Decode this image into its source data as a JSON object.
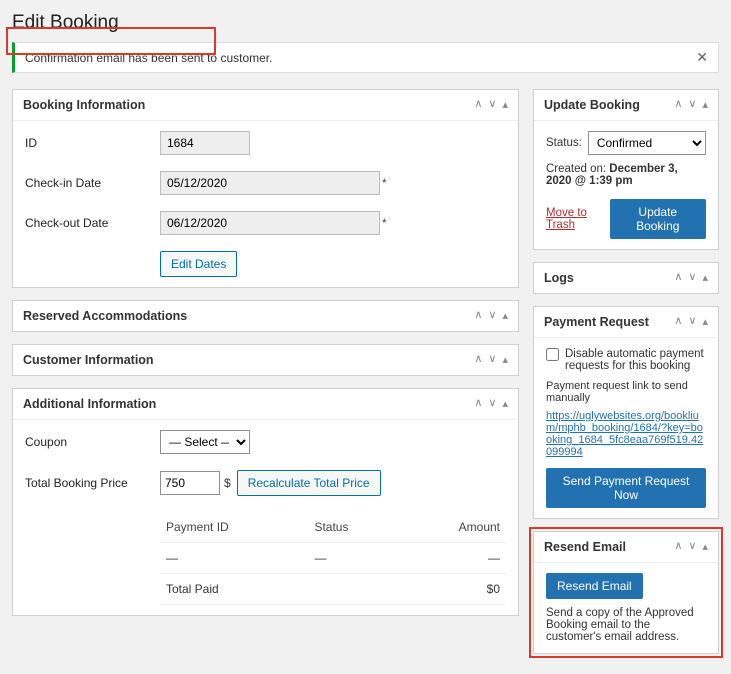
{
  "page_title": "Edit Booking",
  "notice_text": "Confirmation email has been sent to customer.",
  "booking_info": {
    "panel_title": "Booking Information",
    "id_label": "ID",
    "id_value": "1684",
    "checkin_label": "Check-in Date",
    "checkin_value": "05/12/2020",
    "checkout_label": "Check-out Date",
    "checkout_value": "06/12/2020",
    "edit_dates_btn": "Edit Dates"
  },
  "reserved_panel_title": "Reserved Accommodations",
  "customer_panel_title": "Customer Information",
  "additional": {
    "panel_title": "Additional Information",
    "coupon_label": "Coupon",
    "coupon_select": "— Select —",
    "total_label": "Total Booking Price",
    "total_value": "750",
    "currency": "$",
    "recalc_btn": "Recalculate Total Price",
    "col_payment_id": "Payment ID",
    "col_status": "Status",
    "col_amount": "Amount",
    "dash": "—",
    "total_paid_label": "Total Paid",
    "total_paid_value": "$0"
  },
  "update": {
    "panel_title": "Update Booking",
    "status_label": "Status:",
    "status_value": "Confirmed",
    "created_prefix": "Created on: ",
    "created_value": "December 3, 2020 @ 1:39 pm",
    "trash": "Move to Trash",
    "button": "Update Booking"
  },
  "logs_panel_title": "Logs",
  "payment_request": {
    "panel_title": "Payment Request",
    "disable_label": "Disable automatic payment requests for this booking",
    "link_intro": "Payment request link to send manually",
    "link_text": "https://uglywebsites.org/booklium/mphb_booking/1684/?key=booking_1684_5fc8eaa769f519.42099994",
    "button": "Send Payment Request Now"
  },
  "resend": {
    "panel_title": "Resend Email",
    "button": "Resend Email",
    "desc": "Send a copy of the Approved Booking email to the customer's email address."
  }
}
